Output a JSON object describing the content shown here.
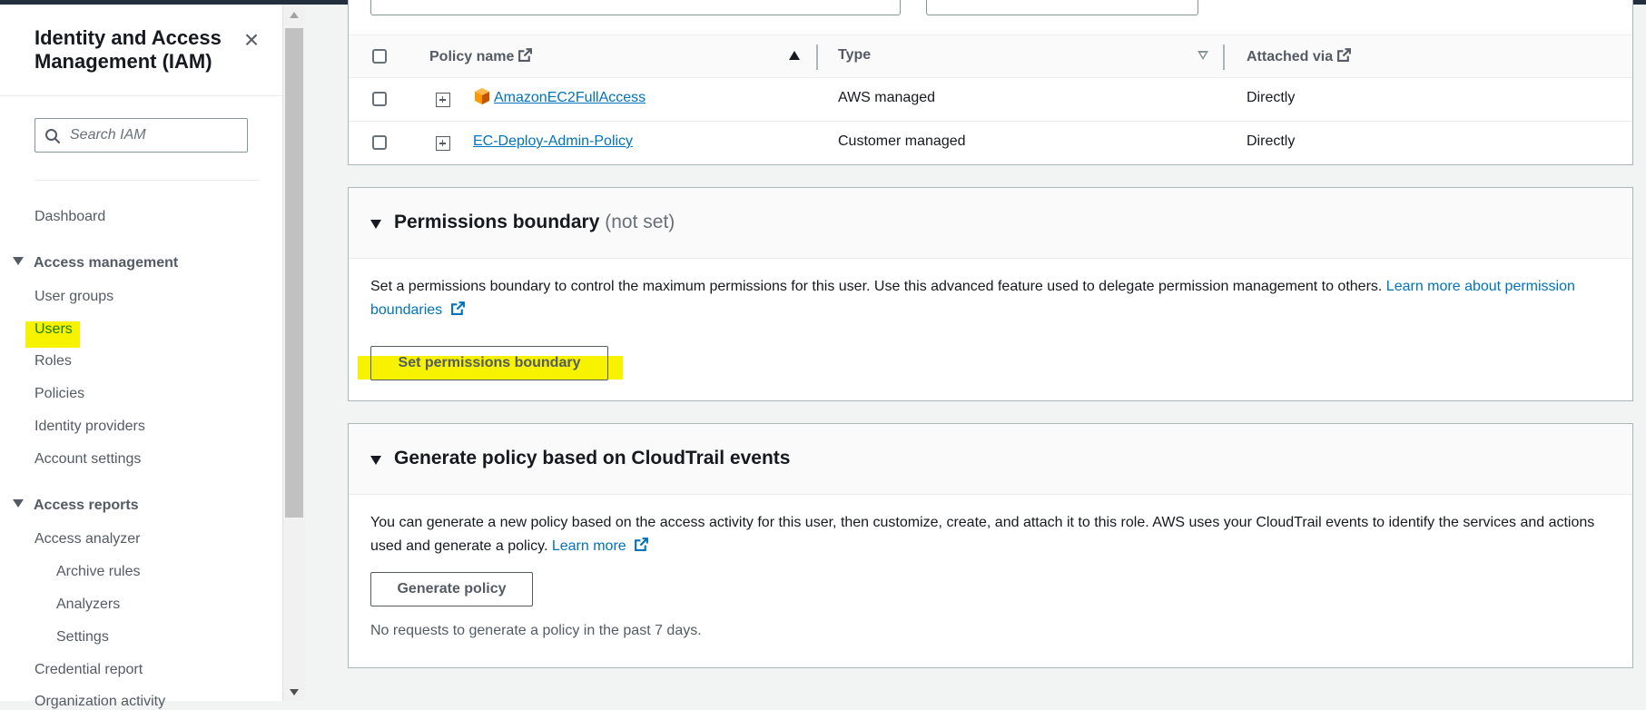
{
  "sidebar": {
    "title": "Identity and Access Management (IAM)",
    "search_placeholder": "Search IAM",
    "dashboard": "Dashboard",
    "access_management": {
      "label": "Access management",
      "items": [
        "User groups",
        "Users",
        "Roles",
        "Policies",
        "Identity providers",
        "Account settings"
      ]
    },
    "access_reports": {
      "label": "Access reports",
      "items": [
        "Access analyzer",
        "Archive rules",
        "Analyzers",
        "Settings",
        "Credential report",
        "Organization activity"
      ]
    },
    "active_item": "Users",
    "highlight_color": "#f6f200"
  },
  "policies_table": {
    "columns": {
      "name": "Policy name",
      "type": "Type",
      "attached": "Attached via"
    },
    "rows": [
      {
        "name": "AmazonEC2FullAccess",
        "type": "AWS managed",
        "attached": "Directly"
      },
      {
        "name": "EC-Deploy-Admin-Policy",
        "type": "Customer managed",
        "attached": "Directly"
      }
    ]
  },
  "permissions_boundary": {
    "title": "Permissions boundary",
    "status": "(not set)",
    "description": "Set a permissions boundary to control the maximum permissions for this user. Use this advanced feature used to delegate permission management to others.",
    "learn_more": "Learn more about permission boundaries",
    "button": "Set permissions boundary"
  },
  "generate_policy": {
    "title": "Generate policy based on CloudTrail events",
    "description": "You can generate a new policy based on the access activity for this user, then customize, create, and attach it to this role. AWS uses your CloudTrail events to identify the services and actions used and generate a policy.",
    "learn_more": "Learn more",
    "button": "Generate policy",
    "note": "No requests to generate a policy in the past 7 days."
  },
  "colors": {
    "link": "#0073bb",
    "active_nav": "#1d8102",
    "aws_orange": "#f90"
  }
}
